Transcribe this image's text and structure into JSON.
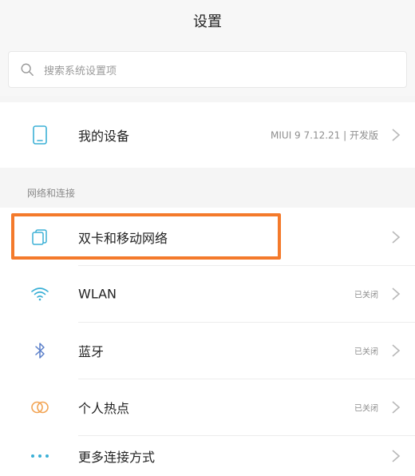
{
  "header": {
    "title": "设置"
  },
  "search": {
    "placeholder": "搜索系统设置项"
  },
  "device": {
    "label": "我的设备",
    "value": "MIUI 9 7.12.21 | 开发版"
  },
  "network_section": {
    "title": "网络和连接",
    "items": [
      {
        "label": "双卡和移动网络",
        "value": "",
        "icon": "dual-sim-icon"
      },
      {
        "label": "WLAN",
        "value": "已关闭",
        "icon": "wifi-icon"
      },
      {
        "label": "蓝牙",
        "value": "已关闭",
        "icon": "bluetooth-icon"
      },
      {
        "label": "个人热点",
        "value": "已关闭",
        "icon": "hotspot-icon"
      },
      {
        "label": "更多连接方式",
        "value": "",
        "icon": "more-dots-icon"
      }
    ]
  },
  "colors": {
    "highlight": "#f47a2b",
    "icon_accent": "#3bb0d6",
    "hotspot_accent": "#f2a454"
  }
}
